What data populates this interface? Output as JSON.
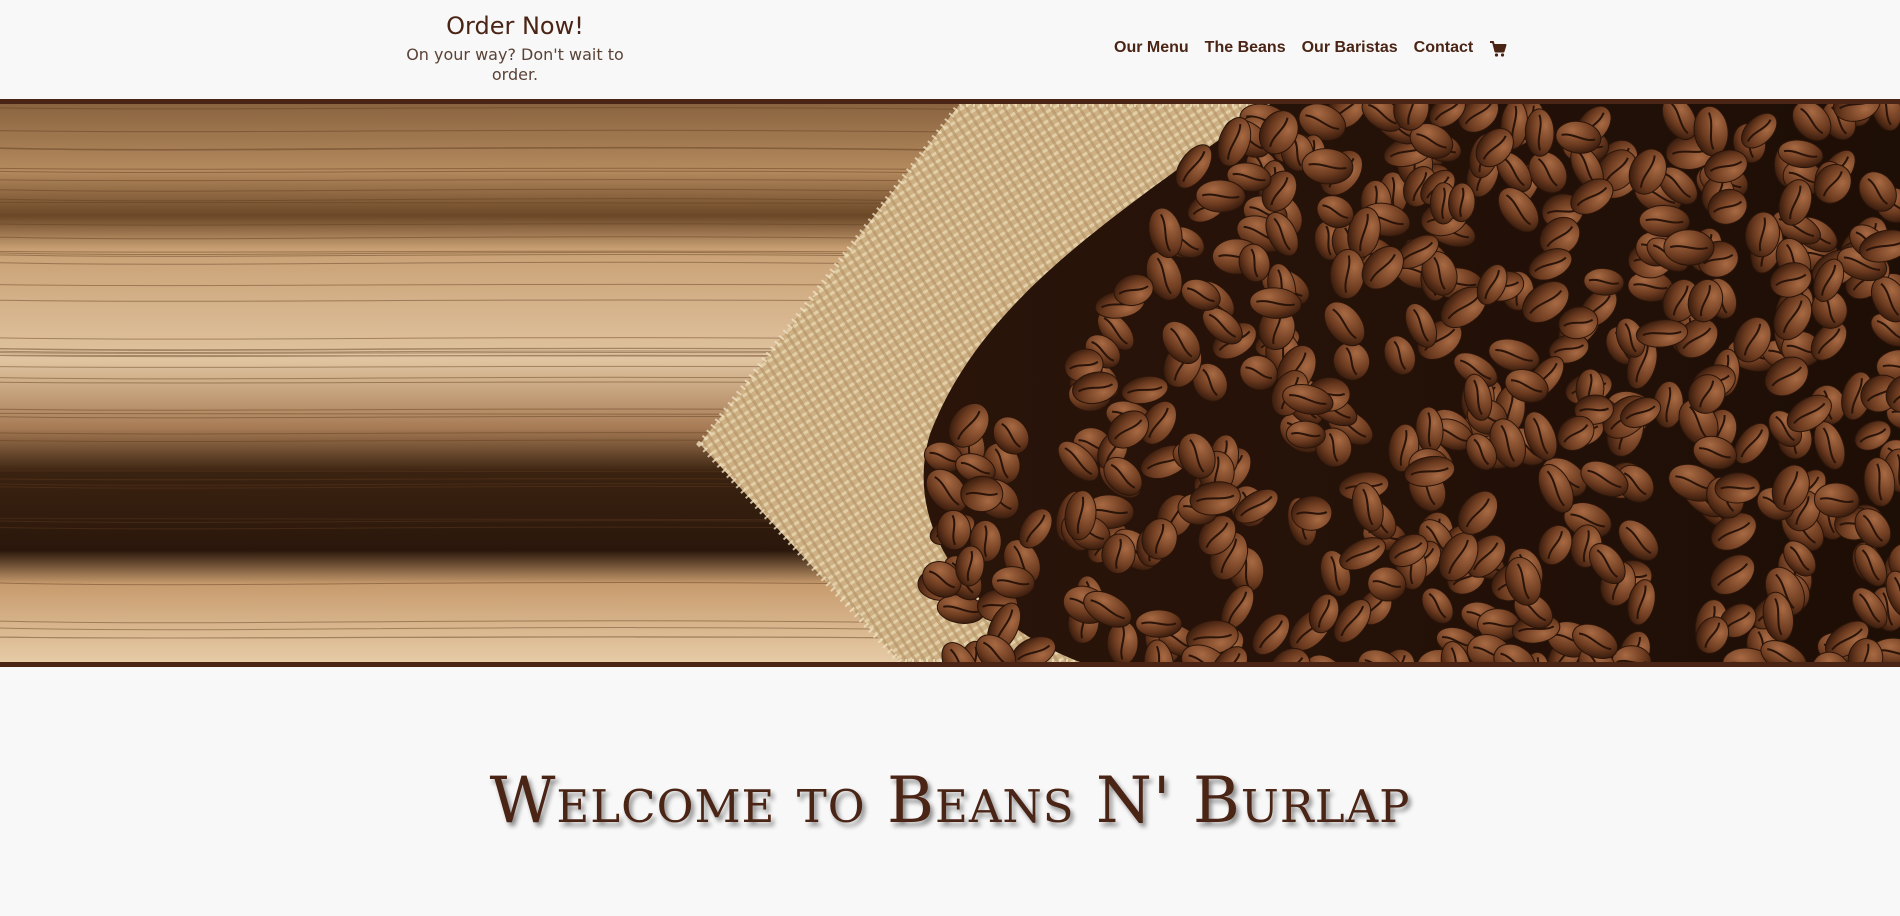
{
  "header": {
    "order_title": "Order Now!",
    "order_subtitle": "On your way? Don't wait to order."
  },
  "nav": {
    "items": [
      {
        "label": "Our Menu"
      },
      {
        "label": "The Beans"
      },
      {
        "label": "Our Baristas"
      },
      {
        "label": "Contact"
      }
    ],
    "cart_icon": "shopping-cart-icon"
  },
  "hero": {
    "image": "coffee-beans-on-burlap-and-wood-image"
  },
  "main": {
    "welcome_heading": "Welcome to Beans N' Burlap"
  },
  "colors": {
    "brand_brown": "#4a2415",
    "background": "#f8f8f8",
    "wood_light": "#c99a6c",
    "wood_dark": "#5a3519",
    "burlap": "#d6bd93",
    "bean": "#6b3a1f"
  }
}
